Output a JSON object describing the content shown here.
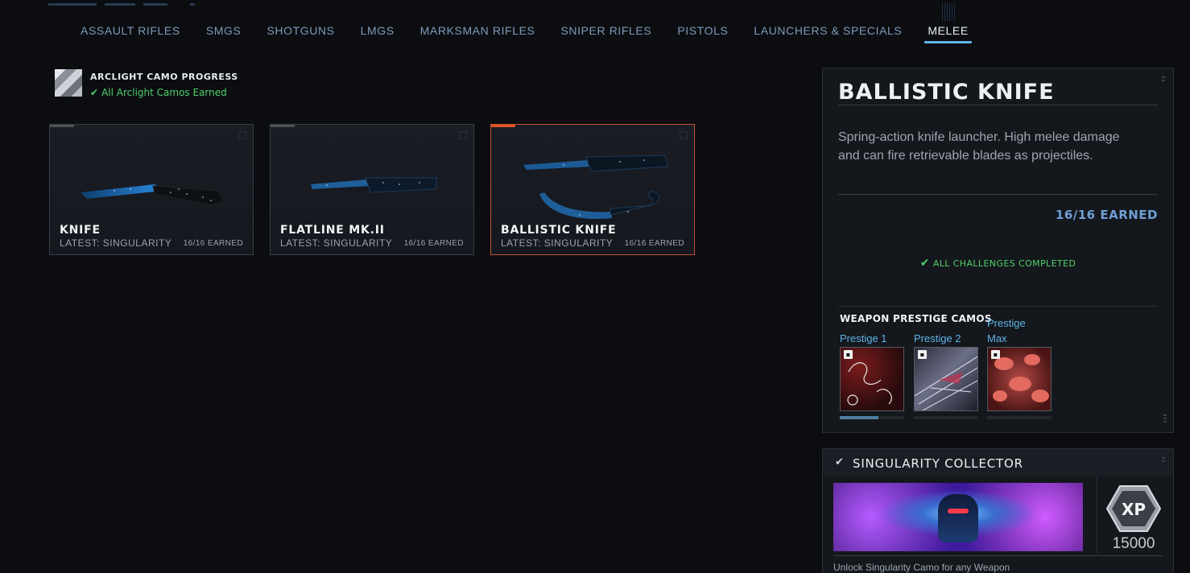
{
  "tabs": [
    {
      "label": "ASSAULT RIFLES"
    },
    {
      "label": "SMGS"
    },
    {
      "label": "SHOTGUNS"
    },
    {
      "label": "LMGS"
    },
    {
      "label": "MARKSMAN RIFLES"
    },
    {
      "label": "SNIPER RIFLES"
    },
    {
      "label": "PISTOLS"
    },
    {
      "label": "LAUNCHERS & SPECIALS"
    },
    {
      "label": "MELEE"
    }
  ],
  "active_tab": "MELEE",
  "arclight": {
    "title": "ARCLIGHT CAMO PROGRESS",
    "status": "All Arclight Camos Earned",
    "status_icon": "check-icon"
  },
  "weapons": [
    {
      "name": "KNIFE",
      "latest": "LATEST: SINGULARITY",
      "earned": "16/16 EARNED"
    },
    {
      "name": "FLATLINE MK.II",
      "latest": "LATEST: SINGULARITY",
      "earned": "16/16 EARNED"
    },
    {
      "name": "BALLISTIC KNIFE",
      "latest": "LATEST: SINGULARITY",
      "earned": "16/16 EARNED"
    }
  ],
  "selected_weapon_index": 2,
  "detail": {
    "title": "BALLISTIC KNIFE",
    "description": "Spring-action knife launcher. High melee damage and can fire retrievable blades as projectiles.",
    "earned": "16/16 EARNED",
    "completed": "ALL CHALLENGES COMPLETED",
    "prestige_title": "WEAPON PRESTIGE CAMOS",
    "prestige": [
      {
        "label": "Prestige 1",
        "progress": 0.6
      },
      {
        "label": "Prestige 2",
        "progress": 0
      },
      {
        "label": "Prestige Max",
        "progress": 0
      }
    ]
  },
  "challenge": {
    "title": "SINGULARITY COLLECTOR",
    "xp_badge": "XP",
    "xp": "15000",
    "description": "Unlock Singularity Camo for any Weapon"
  },
  "colors": {
    "accent_blue": "#5fb6e6",
    "earned_blue": "#6f9fd4",
    "success_green": "#4fd16a",
    "selected_orange": "#e2552a"
  }
}
